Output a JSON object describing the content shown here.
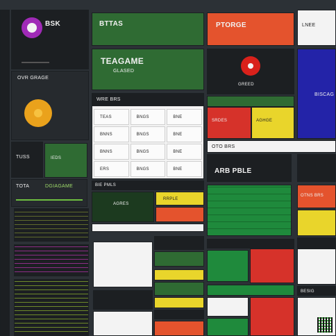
{
  "left_column": {
    "tile_top_label": "BSK",
    "tile_mid_label": "OVR GRAGE",
    "tile_row_label": "TUSS",
    "tile_row2_label": "IEDS"
  },
  "center_top": {
    "green_label": "BTTAS",
    "green2_title": "TEAGAME",
    "green2_sub": "GLASED"
  },
  "red_top": {
    "label": "PTORGE"
  },
  "white_top": {
    "label": "LNEE"
  },
  "record_tile": {
    "caption": "GREED"
  },
  "grid_panel": {
    "header": "WRE BRS",
    "rows": [
      [
        "TEAS",
        "BNGS",
        "BNE"
      ],
      [
        "BNNS",
        "BNGS",
        "BNE"
      ],
      [
        "BNNS",
        "BNGS",
        "BNE"
      ],
      [
        "ERS",
        "BNGS",
        "BNE"
      ]
    ]
  },
  "right_mid": {
    "label": "BISCAG",
    "caption": "OTNS BRS"
  },
  "strip": {
    "label": "OTO BRS"
  },
  "bottom_left": {
    "tag1": "TOTA",
    "tag2": "DGIAGAME"
  },
  "mid_panels": {
    "panel1": "BIE PMLS",
    "panel2": "ARB PBLE",
    "panel3": "SRDES",
    "panel4": "AGHGE"
  },
  "bottom_center": {
    "label": "AGRES",
    "label2": "RRPLE"
  },
  "bottom_right": {
    "label": "BESIG"
  },
  "colors": {
    "accent_green": "#2f6b33",
    "accent_red": "#d6322a",
    "accent_yellow": "#e9d52b",
    "accent_blue": "#2323a8"
  },
  "icons": [
    "purple-ring-icon",
    "orange-coin-icon",
    "record-button-icon",
    "qr-code-icon"
  ]
}
